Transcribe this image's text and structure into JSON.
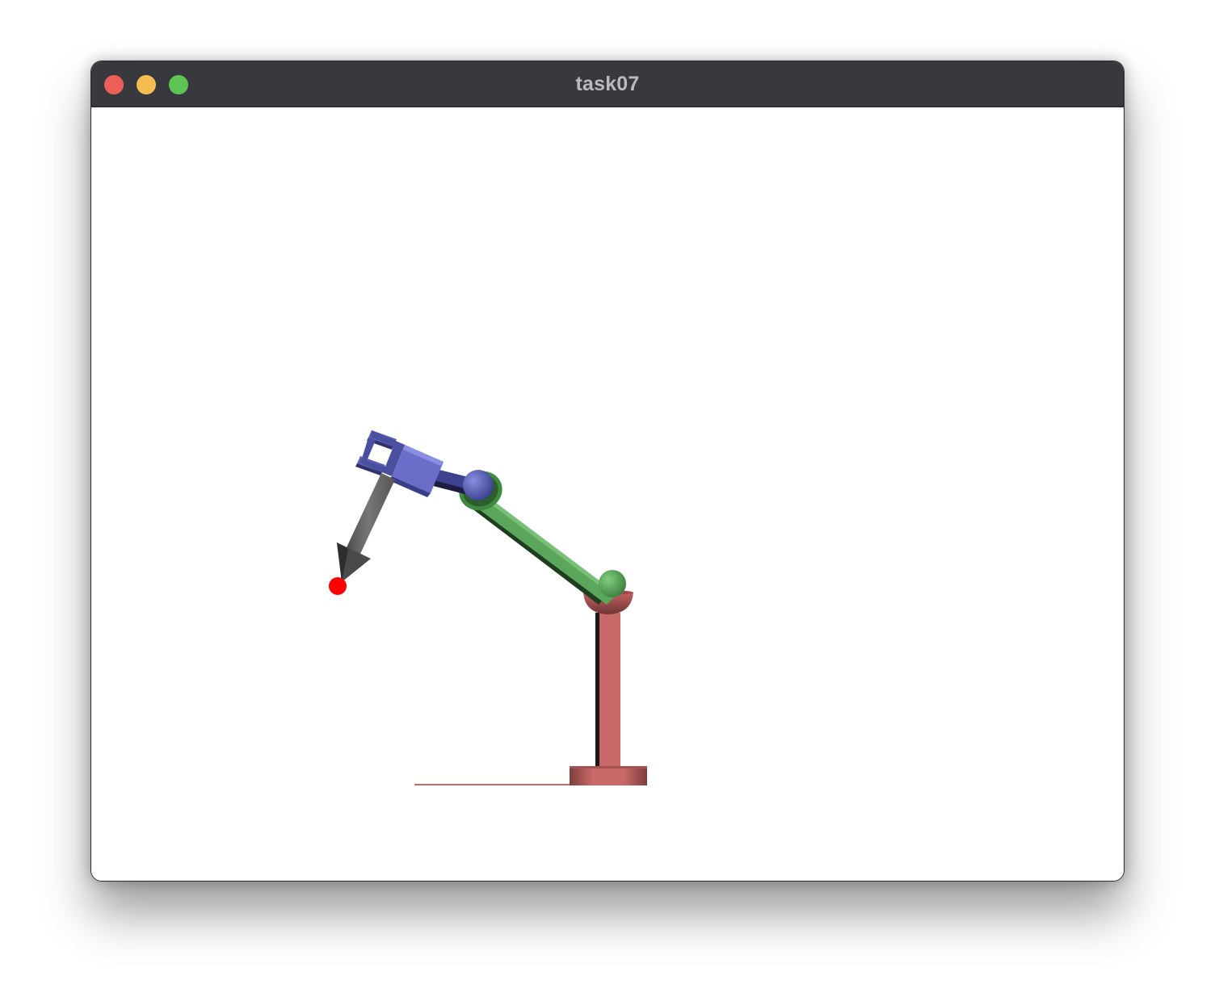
{
  "window": {
    "title": "task07"
  },
  "traffic_lights": {
    "close": {
      "icon": "close-icon",
      "color": "#ec5f57"
    },
    "minimize": {
      "icon": "minimize-icon",
      "color": "#f5bd4f"
    },
    "zoom": {
      "icon": "zoom-icon",
      "color": "#60c454"
    }
  },
  "scene": {
    "colors": {
      "base": "#c96868",
      "base_dark": "#8e4545",
      "upper_arm": "#5aa65a",
      "upper_arm_dark": "#2f5c2f",
      "forearm": "#5b5fb5",
      "forearm_dark": "#33366d",
      "tool": "#6a6a6a",
      "tool_dark": "#333333",
      "target": "#ff0000",
      "shadow": "#1a1a1a"
    }
  }
}
